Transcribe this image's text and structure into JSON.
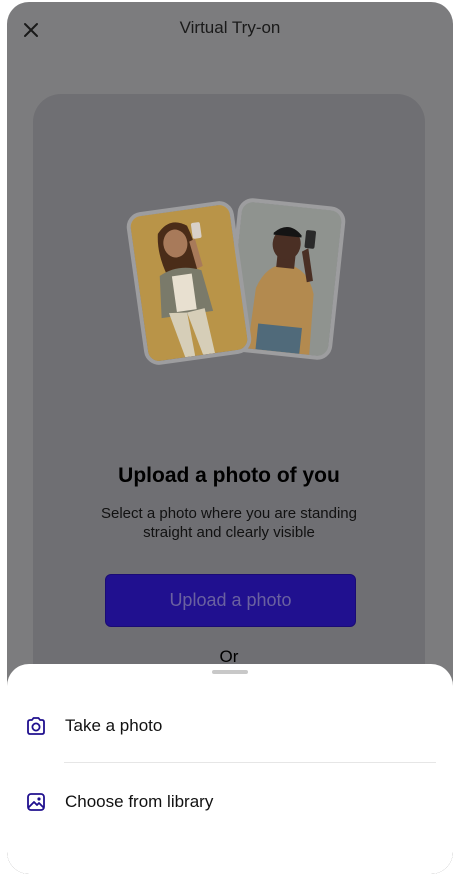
{
  "header": {
    "title": "Virtual Try-on"
  },
  "card": {
    "upload_title": "Upload a photo of you",
    "upload_desc_line1": "Select a photo where you are standing",
    "upload_desc_line2": "straight and clearly visible",
    "upload_button": "Upload a photo",
    "or_text": "Or"
  },
  "sheet": {
    "items": [
      {
        "label": "Take a photo",
        "icon": "camera-icon"
      },
      {
        "label": "Choose from library",
        "icon": "image-gallery-icon"
      }
    ]
  },
  "colors": {
    "accent": "#20108f",
    "icon_color": "#20108f"
  }
}
